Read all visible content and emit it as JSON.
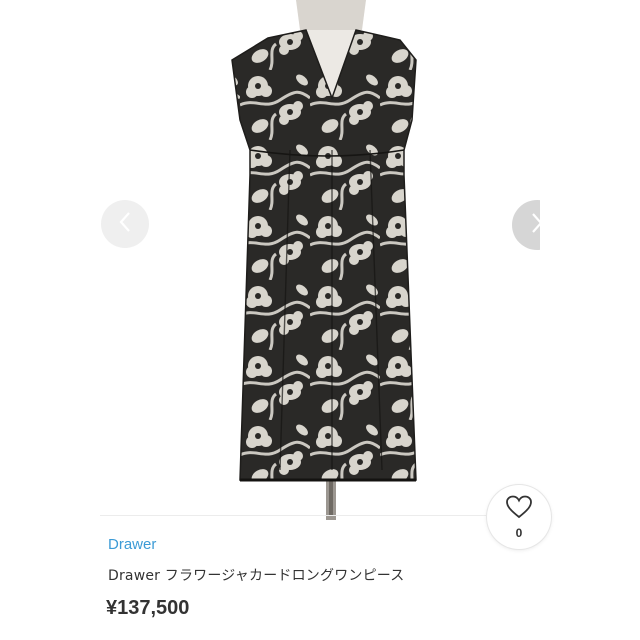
{
  "product": {
    "brand": "Drawer",
    "title": "Drawer フラワージャカードロングワンピース",
    "price": "¥137,500"
  },
  "likes": {
    "count": "0"
  },
  "icons": {
    "like": "heart-icon",
    "prev": "chevron-left-icon",
    "next": "chevron-right-icon"
  },
  "colors": {
    "brand_link": "#3c9bd6",
    "text": "#333333",
    "dress": "#2a2927",
    "pattern": "#e8e4dc"
  }
}
